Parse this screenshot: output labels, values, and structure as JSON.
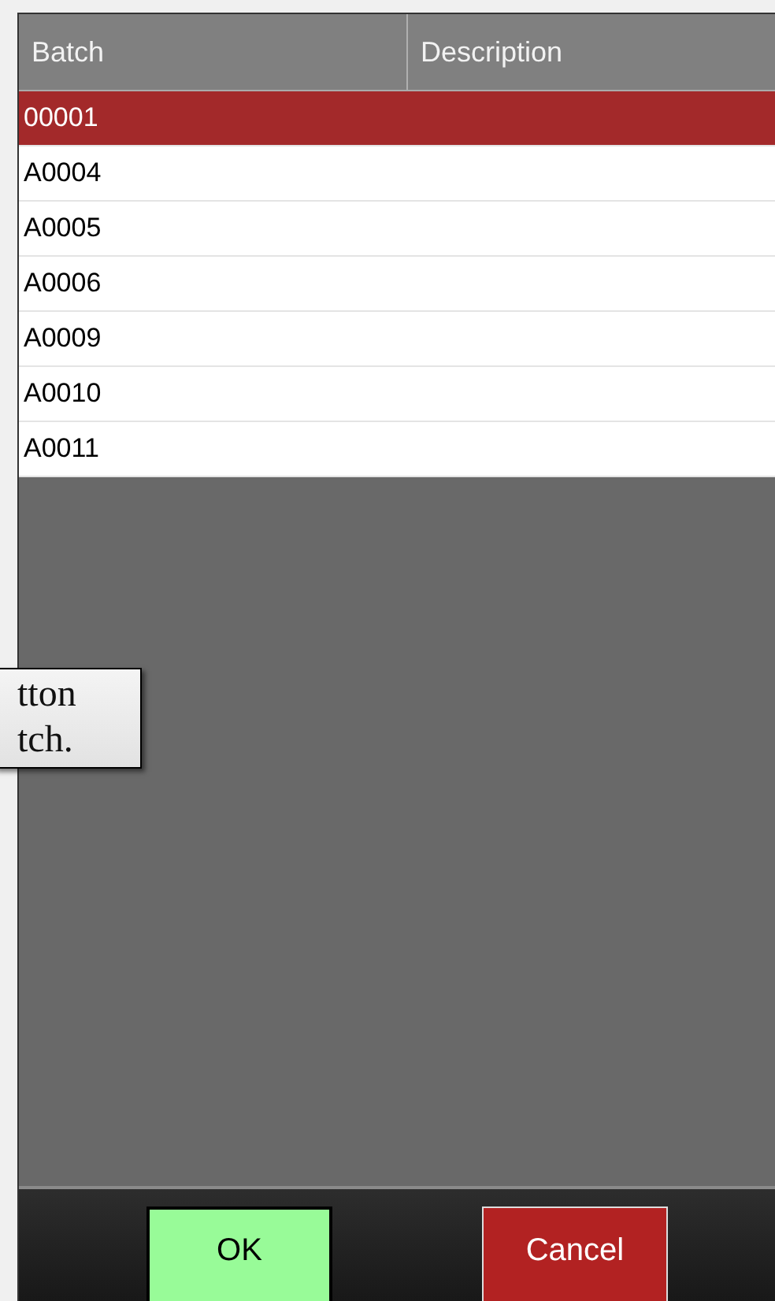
{
  "table": {
    "columns": [
      "Batch",
      "Description"
    ],
    "rows": [
      {
        "cells": [
          "00001"
        ],
        "selected": true
      },
      {
        "cells": [
          "A0004"
        ],
        "selected": false
      },
      {
        "cells": [
          "A0005"
        ],
        "selected": false
      },
      {
        "cells": [
          "A0006"
        ],
        "selected": false
      },
      {
        "cells": [
          "A0009"
        ],
        "selected": false
      },
      {
        "cells": [
          "A0010"
        ],
        "selected": false
      },
      {
        "cells": [
          "A0011"
        ],
        "selected": false
      }
    ]
  },
  "tooltip": {
    "lines": [
      "tton",
      "tch."
    ]
  },
  "buttons": [
    {
      "label": "OK",
      "kind": "confirm"
    },
    {
      "label": "Cancel",
      "kind": "cancel"
    }
  ]
}
